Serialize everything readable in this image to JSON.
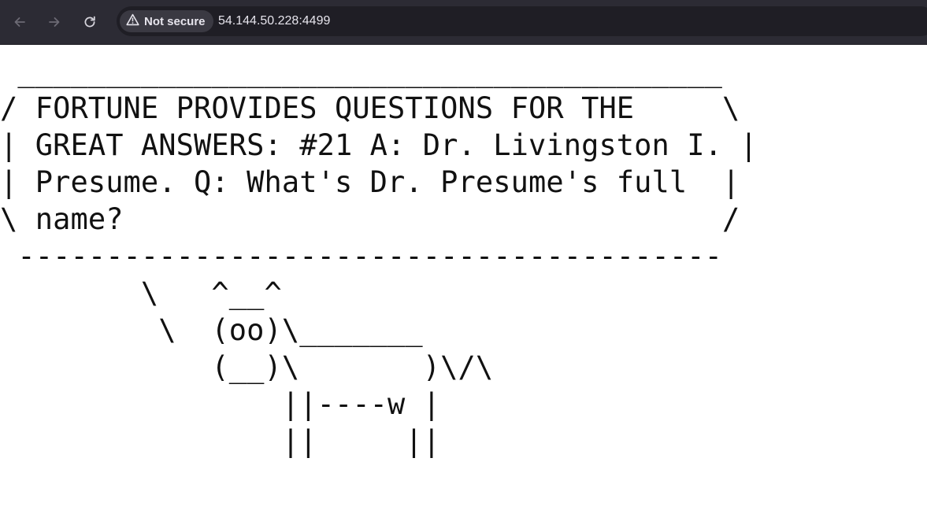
{
  "browser": {
    "security_label": "Not secure",
    "url": "54.144.50.228:4499",
    "icons": {
      "back": "arrow-left-icon",
      "forward": "arrow-right-icon",
      "reload": "reload-icon",
      "security": "warning-triangle-icon"
    }
  },
  "page": {
    "output": " ________________________________________\n/ FORTUNE PROVIDES QUESTIONS FOR THE     \\\n| GREAT ANSWERS: #21 A: Dr. Livingston I. |\n| Presume. Q: What's Dr. Presume's full  |\n\\ name?                                  /\n ----------------------------------------\n        \\   ^__^\n         \\  (oo)\\_______\n            (__)\\       )\\/\\\n                ||----w |\n                ||     ||"
  }
}
